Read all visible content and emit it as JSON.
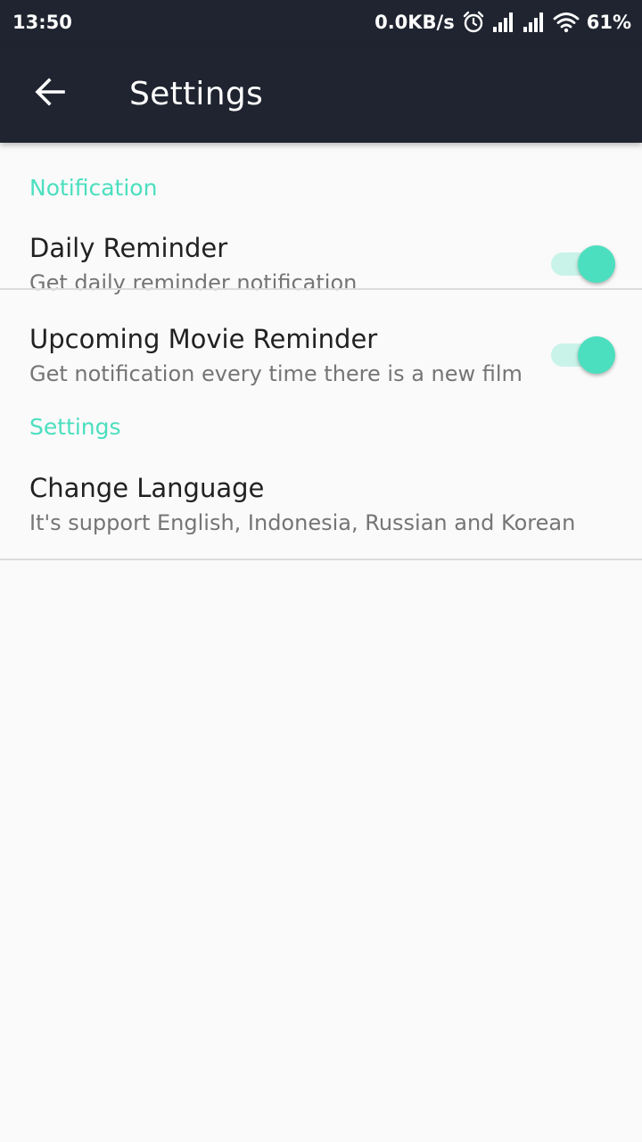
{
  "status_bar": {
    "time": "13:50",
    "network_speed": "0.0KB/s",
    "battery": "61%",
    "icons": [
      "alarm-icon",
      "signal-icon",
      "signal-icon",
      "wifi-icon"
    ]
  },
  "toolbar": {
    "back_icon": "arrow-back-icon",
    "title": "Settings"
  },
  "sections": {
    "notification": {
      "header": "Notification",
      "daily_reminder": {
        "title": "Daily Reminder",
        "summary": "Get daily reminder notification",
        "enabled": true
      },
      "upcoming_reminder": {
        "title": "Upcoming Movie Reminder",
        "summary": "Get notification every time there is a new film",
        "enabled": true
      }
    },
    "settings": {
      "header": "Settings",
      "change_language": {
        "title": "Change Language",
        "summary": "It's support English, Indonesia, Russian and Korean"
      }
    }
  },
  "colors": {
    "toolbar_bg": "#1f2430",
    "accent": "#4bdfbf",
    "background": "#fafafa"
  }
}
